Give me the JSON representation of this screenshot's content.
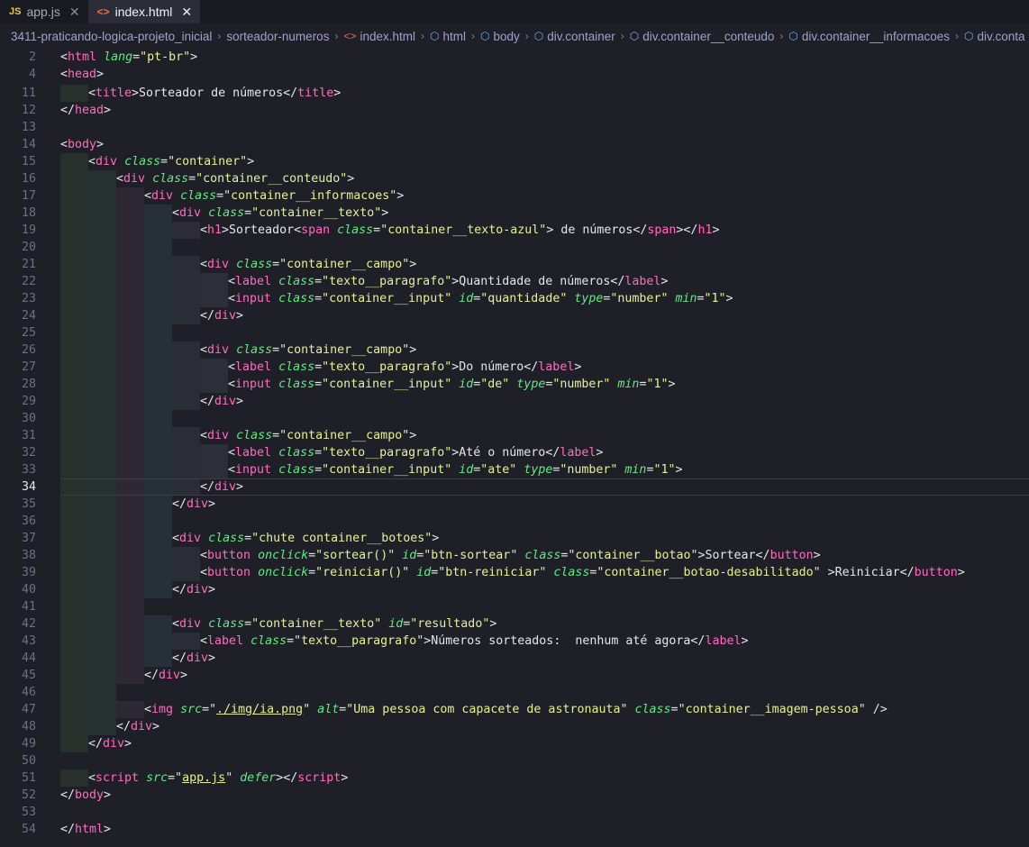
{
  "tabs": [
    {
      "badge": "JS",
      "label": "app.js",
      "active": false
    },
    {
      "badge": "<>",
      "label": "index.html",
      "active": true
    }
  ],
  "breadcrumb": [
    "3411-praticando-logica-projeto_inicial",
    "sorteador-numeros",
    "index.html",
    "html",
    "body",
    "div.container",
    "div.container__conteudo",
    "div.container__informacoes",
    "div.conta"
  ],
  "current_line": "34",
  "lines": [
    {
      "n": "2",
      "indent": 0,
      "tokens": [
        [
          "p",
          "<"
        ],
        [
          "t",
          "html"
        ],
        [
          "p",
          " "
        ],
        [
          "a",
          "lang"
        ],
        [
          "p",
          "="
        ],
        [
          "s",
          "\"pt-br\""
        ],
        [
          "p",
          ">"
        ]
      ]
    },
    {
      "n": "4",
      "indent": 0,
      "tokens": [
        [
          "p",
          "<"
        ],
        [
          "t",
          "head"
        ],
        [
          "p",
          ">"
        ]
      ]
    },
    {
      "n": "11",
      "indent": 1,
      "tokens": [
        [
          "p",
          "<"
        ],
        [
          "t",
          "title"
        ],
        [
          "p",
          ">Sorteador de números</"
        ],
        [
          "t",
          "title"
        ],
        [
          "p",
          ">"
        ]
      ]
    },
    {
      "n": "12",
      "indent": 0,
      "tokens": [
        [
          "p",
          "</"
        ],
        [
          "t",
          "head"
        ],
        [
          "p",
          ">"
        ]
      ]
    },
    {
      "n": "13",
      "indent": 0,
      "tokens": []
    },
    {
      "n": "14",
      "indent": 0,
      "tokens": [
        [
          "p",
          "<"
        ],
        [
          "t",
          "body"
        ],
        [
          "p",
          ">"
        ]
      ]
    },
    {
      "n": "15",
      "indent": 1,
      "tokens": [
        [
          "p",
          "<"
        ],
        [
          "t",
          "div"
        ],
        [
          "p",
          " "
        ],
        [
          "a",
          "class"
        ],
        [
          "p",
          "="
        ],
        [
          "s",
          "\"container\""
        ],
        [
          "p",
          ">"
        ]
      ]
    },
    {
      "n": "16",
      "indent": 2,
      "tokens": [
        [
          "p",
          "<"
        ],
        [
          "t",
          "div"
        ],
        [
          "p",
          " "
        ],
        [
          "a",
          "class"
        ],
        [
          "p",
          "="
        ],
        [
          "s",
          "\"container__conteudo\""
        ],
        [
          "p",
          ">"
        ]
      ]
    },
    {
      "n": "17",
      "indent": 3,
      "tokens": [
        [
          "p",
          "<"
        ],
        [
          "t",
          "div"
        ],
        [
          "p",
          " "
        ],
        [
          "a",
          "class"
        ],
        [
          "p",
          "="
        ],
        [
          "s",
          "\"container__informacoes\""
        ],
        [
          "p",
          ">"
        ]
      ]
    },
    {
      "n": "18",
      "indent": 4,
      "tokens": [
        [
          "p",
          "<"
        ],
        [
          "t",
          "div"
        ],
        [
          "p",
          " "
        ],
        [
          "a",
          "class"
        ],
        [
          "p",
          "="
        ],
        [
          "s",
          "\"container__texto\""
        ],
        [
          "p",
          ">"
        ]
      ]
    },
    {
      "n": "19",
      "indent": 5,
      "tokens": [
        [
          "p",
          "<"
        ],
        [
          "t",
          "h1"
        ],
        [
          "p",
          ">Sorteador<"
        ],
        [
          "t",
          "span"
        ],
        [
          "p",
          " "
        ],
        [
          "a",
          "class"
        ],
        [
          "p",
          "="
        ],
        [
          "s",
          "\"container__texto-azul\""
        ],
        [
          "p",
          "> de números</"
        ],
        [
          "t",
          "span"
        ],
        [
          "p",
          "></"
        ],
        [
          "t",
          "h1"
        ],
        [
          "p",
          ">"
        ]
      ]
    },
    {
      "n": "20",
      "indent": 4,
      "tokens": []
    },
    {
      "n": "21",
      "indent": 5,
      "tokens": [
        [
          "p",
          "<"
        ],
        [
          "t",
          "div"
        ],
        [
          "p",
          " "
        ],
        [
          "a",
          "class"
        ],
        [
          "p",
          "="
        ],
        [
          "s",
          "\"container__campo\""
        ],
        [
          "p",
          ">"
        ]
      ]
    },
    {
      "n": "22",
      "indent": 6,
      "tokens": [
        [
          "p",
          "<"
        ],
        [
          "t",
          "label"
        ],
        [
          "p",
          " "
        ],
        [
          "a",
          "class"
        ],
        [
          "p",
          "="
        ],
        [
          "s",
          "\"texto__paragrafo\""
        ],
        [
          "p",
          ">Quantidade de números</"
        ],
        [
          "t",
          "label"
        ],
        [
          "p",
          ">"
        ]
      ]
    },
    {
      "n": "23",
      "indent": 6,
      "tokens": [
        [
          "p",
          "<"
        ],
        [
          "t",
          "input"
        ],
        [
          "p",
          " "
        ],
        [
          "a",
          "class"
        ],
        [
          "p",
          "="
        ],
        [
          "s",
          "\"container__input\""
        ],
        [
          "p",
          " "
        ],
        [
          "a",
          "id"
        ],
        [
          "p",
          "="
        ],
        [
          "s",
          "\"quantidade\""
        ],
        [
          "p",
          " "
        ],
        [
          "a",
          "type"
        ],
        [
          "p",
          "="
        ],
        [
          "s",
          "\"number\""
        ],
        [
          "p",
          " "
        ],
        [
          "a",
          "min"
        ],
        [
          "p",
          "="
        ],
        [
          "s",
          "\"1\""
        ],
        [
          "p",
          ">"
        ]
      ]
    },
    {
      "n": "24",
      "indent": 5,
      "tokens": [
        [
          "p",
          "</"
        ],
        [
          "t",
          "div"
        ],
        [
          "p",
          ">"
        ]
      ]
    },
    {
      "n": "25",
      "indent": 4,
      "tokens": []
    },
    {
      "n": "26",
      "indent": 5,
      "tokens": [
        [
          "p",
          "<"
        ],
        [
          "t",
          "div"
        ],
        [
          "p",
          " "
        ],
        [
          "a",
          "class"
        ],
        [
          "p",
          "="
        ],
        [
          "s",
          "\"container__campo\""
        ],
        [
          "p",
          ">"
        ]
      ]
    },
    {
      "n": "27",
      "indent": 6,
      "tokens": [
        [
          "p",
          "<"
        ],
        [
          "t",
          "label"
        ],
        [
          "p",
          " "
        ],
        [
          "a",
          "class"
        ],
        [
          "p",
          "="
        ],
        [
          "s",
          "\"texto__paragrafo\""
        ],
        [
          "p",
          ">Do número</"
        ],
        [
          "t",
          "label"
        ],
        [
          "p",
          ">"
        ]
      ]
    },
    {
      "n": "28",
      "indent": 6,
      "tokens": [
        [
          "p",
          "<"
        ],
        [
          "t",
          "input"
        ],
        [
          "p",
          " "
        ],
        [
          "a",
          "class"
        ],
        [
          "p",
          "="
        ],
        [
          "s",
          "\"container__input\""
        ],
        [
          "p",
          " "
        ],
        [
          "a",
          "id"
        ],
        [
          "p",
          "="
        ],
        [
          "s",
          "\"de\""
        ],
        [
          "p",
          " "
        ],
        [
          "a",
          "type"
        ],
        [
          "p",
          "="
        ],
        [
          "s",
          "\"number\""
        ],
        [
          "p",
          " "
        ],
        [
          "a",
          "min"
        ],
        [
          "p",
          "="
        ],
        [
          "s",
          "\"1\""
        ],
        [
          "p",
          ">"
        ]
      ]
    },
    {
      "n": "29",
      "indent": 5,
      "tokens": [
        [
          "p",
          "</"
        ],
        [
          "t",
          "div"
        ],
        [
          "p",
          ">"
        ]
      ]
    },
    {
      "n": "30",
      "indent": 4,
      "tokens": []
    },
    {
      "n": "31",
      "indent": 5,
      "tokens": [
        [
          "p",
          "<"
        ],
        [
          "t",
          "div"
        ],
        [
          "p",
          " "
        ],
        [
          "a",
          "class"
        ],
        [
          "p",
          "="
        ],
        [
          "s",
          "\"container__campo\""
        ],
        [
          "p",
          ">"
        ]
      ]
    },
    {
      "n": "32",
      "indent": 6,
      "tokens": [
        [
          "p",
          "<"
        ],
        [
          "t",
          "label"
        ],
        [
          "p",
          " "
        ],
        [
          "a",
          "class"
        ],
        [
          "p",
          "="
        ],
        [
          "s",
          "\"texto__paragrafo\""
        ],
        [
          "p",
          ">Até o número</"
        ],
        [
          "t",
          "label"
        ],
        [
          "p",
          ">"
        ]
      ]
    },
    {
      "n": "33",
      "indent": 6,
      "tokens": [
        [
          "p",
          "<"
        ],
        [
          "t",
          "input"
        ],
        [
          "p",
          " "
        ],
        [
          "a",
          "class"
        ],
        [
          "p",
          "="
        ],
        [
          "s",
          "\"container__input\""
        ],
        [
          "p",
          " "
        ],
        [
          "a",
          "id"
        ],
        [
          "p",
          "="
        ],
        [
          "s",
          "\"ate\""
        ],
        [
          "p",
          " "
        ],
        [
          "a",
          "type"
        ],
        [
          "p",
          "="
        ],
        [
          "s",
          "\"number\""
        ],
        [
          "p",
          " "
        ],
        [
          "a",
          "min"
        ],
        [
          "p",
          "="
        ],
        [
          "s",
          "\"1\""
        ],
        [
          "p",
          ">"
        ]
      ]
    },
    {
      "n": "34",
      "indent": 5,
      "tokens": [
        [
          "p",
          "</"
        ],
        [
          "t",
          "div"
        ],
        [
          "p",
          ">"
        ]
      ]
    },
    {
      "n": "35",
      "indent": 4,
      "tokens": [
        [
          "p",
          "</"
        ],
        [
          "t",
          "div"
        ],
        [
          "p",
          ">"
        ]
      ]
    },
    {
      "n": "36",
      "indent": 4,
      "tokens": []
    },
    {
      "n": "37",
      "indent": 4,
      "tokens": [
        [
          "p",
          "<"
        ],
        [
          "t",
          "div"
        ],
        [
          "p",
          " "
        ],
        [
          "a",
          "class"
        ],
        [
          "p",
          "="
        ],
        [
          "s",
          "\"chute container__botoes\""
        ],
        [
          "p",
          ">"
        ]
      ]
    },
    {
      "n": "38",
      "indent": 5,
      "tokens": [
        [
          "p",
          "<"
        ],
        [
          "t",
          "button"
        ],
        [
          "p",
          " "
        ],
        [
          "a",
          "onclick"
        ],
        [
          "p",
          "="
        ],
        [
          "s",
          "\"sortear()\""
        ],
        [
          "p",
          " "
        ],
        [
          "a",
          "id"
        ],
        [
          "p",
          "="
        ],
        [
          "s",
          "\"btn-sortear\""
        ],
        [
          "p",
          " "
        ],
        [
          "a",
          "class"
        ],
        [
          "p",
          "="
        ],
        [
          "s",
          "\"container__botao\""
        ],
        [
          "p",
          ">Sortear</"
        ],
        [
          "t",
          "button"
        ],
        [
          "p",
          ">"
        ]
      ]
    },
    {
      "n": "39",
      "indent": 5,
      "tokens": [
        [
          "p",
          "<"
        ],
        [
          "t",
          "button"
        ],
        [
          "p",
          " "
        ],
        [
          "a",
          "onclick"
        ],
        [
          "p",
          "="
        ],
        [
          "s",
          "\"reiniciar()\""
        ],
        [
          "p",
          " "
        ],
        [
          "a",
          "id"
        ],
        [
          "p",
          "="
        ],
        [
          "s",
          "\"btn-reiniciar\""
        ],
        [
          "p",
          " "
        ],
        [
          "a",
          "class"
        ],
        [
          "p",
          "="
        ],
        [
          "s",
          "\"container__botao-desabilitado\""
        ],
        [
          "p",
          " >Reiniciar</"
        ],
        [
          "t",
          "button"
        ],
        [
          "p",
          ">"
        ]
      ]
    },
    {
      "n": "40",
      "indent": 4,
      "tokens": [
        [
          "p",
          "</"
        ],
        [
          "t",
          "div"
        ],
        [
          "p",
          ">"
        ]
      ]
    },
    {
      "n": "41",
      "indent": 3,
      "tokens": []
    },
    {
      "n": "42",
      "indent": 4,
      "tokens": [
        [
          "p",
          "<"
        ],
        [
          "t",
          "div"
        ],
        [
          "p",
          " "
        ],
        [
          "a",
          "class"
        ],
        [
          "p",
          "="
        ],
        [
          "s",
          "\"container__texto\""
        ],
        [
          "p",
          " "
        ],
        [
          "a",
          "id"
        ],
        [
          "p",
          "="
        ],
        [
          "s",
          "\"resultado\""
        ],
        [
          "p",
          ">"
        ]
      ]
    },
    {
      "n": "43",
      "indent": 5,
      "tokens": [
        [
          "p",
          "<"
        ],
        [
          "t",
          "label"
        ],
        [
          "p",
          " "
        ],
        [
          "a",
          "class"
        ],
        [
          "p",
          "="
        ],
        [
          "s",
          "\"texto__paragrafo\""
        ],
        [
          "p",
          ">Números sorteados:  nenhum até agora</"
        ],
        [
          "t",
          "label"
        ],
        [
          "p",
          ">"
        ]
      ]
    },
    {
      "n": "44",
      "indent": 4,
      "tokens": [
        [
          "p",
          "</"
        ],
        [
          "t",
          "div"
        ],
        [
          "p",
          ">"
        ]
      ]
    },
    {
      "n": "45",
      "indent": 3,
      "tokens": [
        [
          "p",
          "</"
        ],
        [
          "t",
          "div"
        ],
        [
          "p",
          ">"
        ]
      ]
    },
    {
      "n": "46",
      "indent": 2,
      "tokens": []
    },
    {
      "n": "47",
      "indent": 3,
      "tokens": [
        [
          "p",
          "<"
        ],
        [
          "t",
          "img"
        ],
        [
          "p",
          " "
        ],
        [
          "a",
          "src"
        ],
        [
          "p",
          "="
        ],
        [
          "s",
          "\""
        ],
        [
          "lnk",
          "./img/ia.png"
        ],
        [
          "s",
          "\""
        ],
        [
          "p",
          " "
        ],
        [
          "a",
          "alt"
        ],
        [
          "p",
          "="
        ],
        [
          "s",
          "\"Uma pessoa com capacete de astronauta\""
        ],
        [
          "p",
          " "
        ],
        [
          "a",
          "class"
        ],
        [
          "p",
          "="
        ],
        [
          "s",
          "\"container__imagem-pessoa\""
        ],
        [
          "p",
          " />"
        ]
      ]
    },
    {
      "n": "48",
      "indent": 2,
      "tokens": [
        [
          "p",
          "</"
        ],
        [
          "t",
          "div"
        ],
        [
          "p",
          ">"
        ]
      ]
    },
    {
      "n": "49",
      "indent": 1,
      "tokens": [
        [
          "p",
          "</"
        ],
        [
          "t",
          "div"
        ],
        [
          "p",
          ">"
        ]
      ]
    },
    {
      "n": "50",
      "indent": 0,
      "tokens": []
    },
    {
      "n": "51",
      "indent": 1,
      "tokens": [
        [
          "p",
          "<"
        ],
        [
          "t",
          "script"
        ],
        [
          "p",
          " "
        ],
        [
          "a",
          "src"
        ],
        [
          "p",
          "="
        ],
        [
          "s",
          "\""
        ],
        [
          "lnk",
          "app.js"
        ],
        [
          "s",
          "\""
        ],
        [
          "p",
          " "
        ],
        [
          "a",
          "defer"
        ],
        [
          "p",
          "></"
        ],
        [
          "t",
          "script"
        ],
        [
          "p",
          ">"
        ]
      ]
    },
    {
      "n": "52",
      "indent": 0,
      "tokens": [
        [
          "p",
          "</"
        ],
        [
          "t",
          "body"
        ],
        [
          "p",
          ">"
        ]
      ]
    },
    {
      "n": "53",
      "indent": 0,
      "tokens": []
    },
    {
      "n": "54",
      "indent": 0,
      "tokens": [
        [
          "p",
          "</"
        ],
        [
          "t",
          "html"
        ],
        [
          "p",
          ">"
        ]
      ]
    }
  ]
}
